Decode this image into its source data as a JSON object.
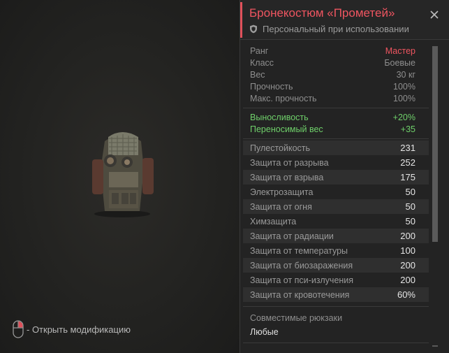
{
  "item": {
    "title": "Бронекостюм «Прометей»",
    "binding": "Персональный при использовании",
    "binding_icon": "shield-icon"
  },
  "hint": {
    "icon": "mouse-right-click-icon",
    "text": "- Открыть модификацию"
  },
  "info": [
    {
      "label": "Ранг",
      "value": "Мастер"
    },
    {
      "label": "Класс",
      "value": "Боевые"
    },
    {
      "label": "Вес",
      "value": "30 кг"
    },
    {
      "label": "Прочность",
      "value": "100%"
    },
    {
      "label": "Макс. прочность",
      "value": "100%"
    }
  ],
  "bonuses": [
    {
      "label": "Выносливость",
      "value": "+20%"
    },
    {
      "label": "Переносимый вес",
      "value": "+35"
    }
  ],
  "protection": [
    {
      "label": "Пулестойкость",
      "value": "231"
    },
    {
      "label": "Защита от разрыва",
      "value": "252"
    },
    {
      "label": "Защита от взрыва",
      "value": "175"
    },
    {
      "label": "Электрозащита",
      "value": "50"
    },
    {
      "label": "Защита от огня",
      "value": "50"
    },
    {
      "label": "Химзащита",
      "value": "50"
    },
    {
      "label": "Защита от радиации",
      "value": "200"
    },
    {
      "label": "Защита от температуры",
      "value": "100"
    },
    {
      "label": "Защита от биозаражения",
      "value": "200"
    },
    {
      "label": "Защита от пси-излучения",
      "value": "200"
    },
    {
      "label": "Защита от кровотечения",
      "value": "60%"
    }
  ],
  "compat": {
    "label": "Совместимые рюкзаки",
    "value": "Любые"
  },
  "colors": {
    "accent": "#ee5560",
    "bonus": "#6fd06a"
  }
}
